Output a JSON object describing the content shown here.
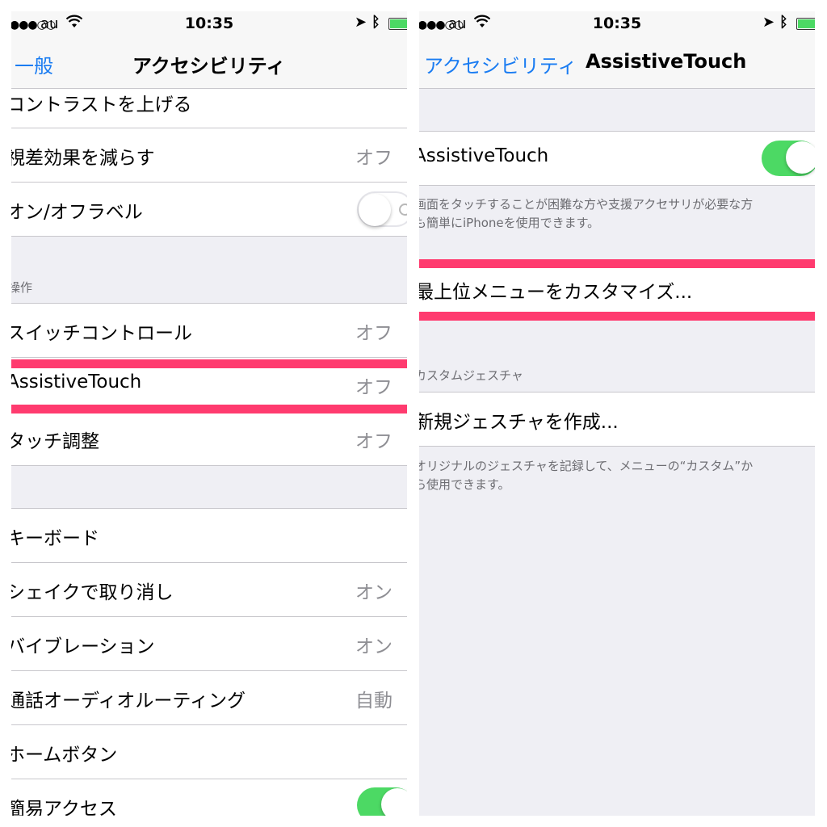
{
  "status_bar": {
    "carrier": "au",
    "time": "10:35"
  },
  "left": {
    "nav": {
      "back": "一般",
      "title": "アクセシビリティ"
    },
    "rows": [
      {
        "label": "コントラストを上げる",
        "value": ""
      },
      {
        "label": "視差効果を減らす",
        "value": "オフ"
      },
      {
        "label": "オン/オフラベル",
        "value": ""
      },
      {
        "label": "スイッチコントロール",
        "value": "オフ"
      },
      {
        "label": "AssistiveTouch",
        "value": "オフ"
      },
      {
        "label": "タッチ調整",
        "value": "オフ"
      },
      {
        "label": "キーボード",
        "value": ""
      },
      {
        "label": "シェイクで取り消し",
        "value": "オン"
      },
      {
        "label": "バイブレーション",
        "value": "オン"
      },
      {
        "label": "通話オーディオルーティング",
        "value": "自動"
      },
      {
        "label": "ホームボタン",
        "value": ""
      },
      {
        "label": "簡易アクセス",
        "value": ""
      }
    ],
    "section_header": "操作",
    "toggles": {
      "onoff_labels": false,
      "reachability": true
    }
  },
  "right": {
    "nav": {
      "back": "アクセシビリティ",
      "title": "AssistiveTouch"
    },
    "assistive_row": "AssistiveTouch",
    "assistive_on": true,
    "description_lines": [
      "画面をタッチすることが困難な方や支援アクセサリが必要な方",
      "も簡単にiPhoneを使用できます。"
    ],
    "customize_row": "最上位メニューをカスタマイズ...",
    "section_header": "カスタムジェスチャ",
    "new_gesture_row": "新規ジェスチャを作成...",
    "gesture_note_lines": [
      "オリジナルのジェスチャを記録して、メニューの“カスタム”か",
      "ら使用できます。"
    ]
  },
  "colors": {
    "tint": "#1a7cf2",
    "switch_on": "#4cd964",
    "highlight": "#ff3b6f",
    "grouped_bg": "#efeff4"
  },
  "icons": [
    "signal-dots-icon",
    "wifi-icon",
    "location-arrow-icon",
    "bluetooth-icon",
    "battery-icon",
    "chevron-right-icon"
  ]
}
